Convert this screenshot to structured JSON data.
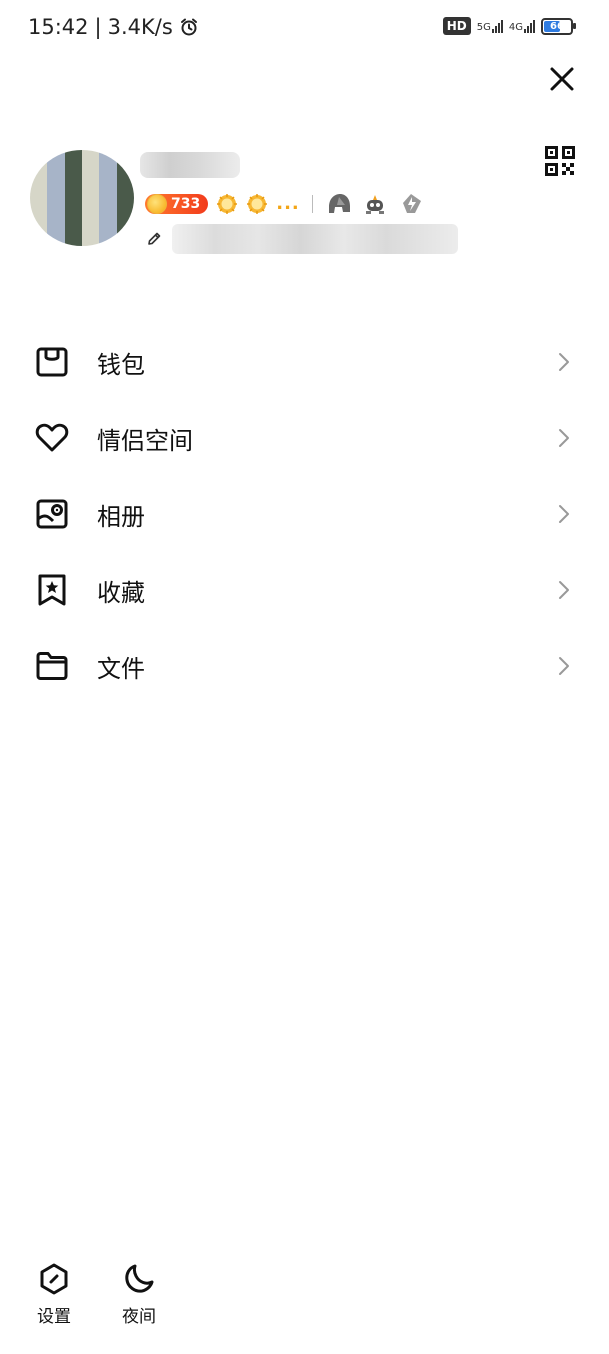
{
  "status_bar": {
    "time": "15:42",
    "speed": "3.4K/s",
    "hd_badge": "HD",
    "network_1": "5G",
    "network_2": "4G",
    "battery": "66",
    "battery_fraction": 0.66,
    "battery_color": "#2e7be0"
  },
  "profile": {
    "coin_value": "733",
    "more_dots": "..."
  },
  "menu": {
    "items": [
      {
        "label": "钱包",
        "icon": "wallet-icon"
      },
      {
        "label": "情侣空间",
        "icon": "heart-icon"
      },
      {
        "label": "相册",
        "icon": "album-icon"
      },
      {
        "label": "收藏",
        "icon": "bookmark-star-icon"
      },
      {
        "label": "文件",
        "icon": "folder-icon"
      }
    ]
  },
  "bottom": {
    "settings_label": "设置",
    "night_label": "夜间"
  }
}
